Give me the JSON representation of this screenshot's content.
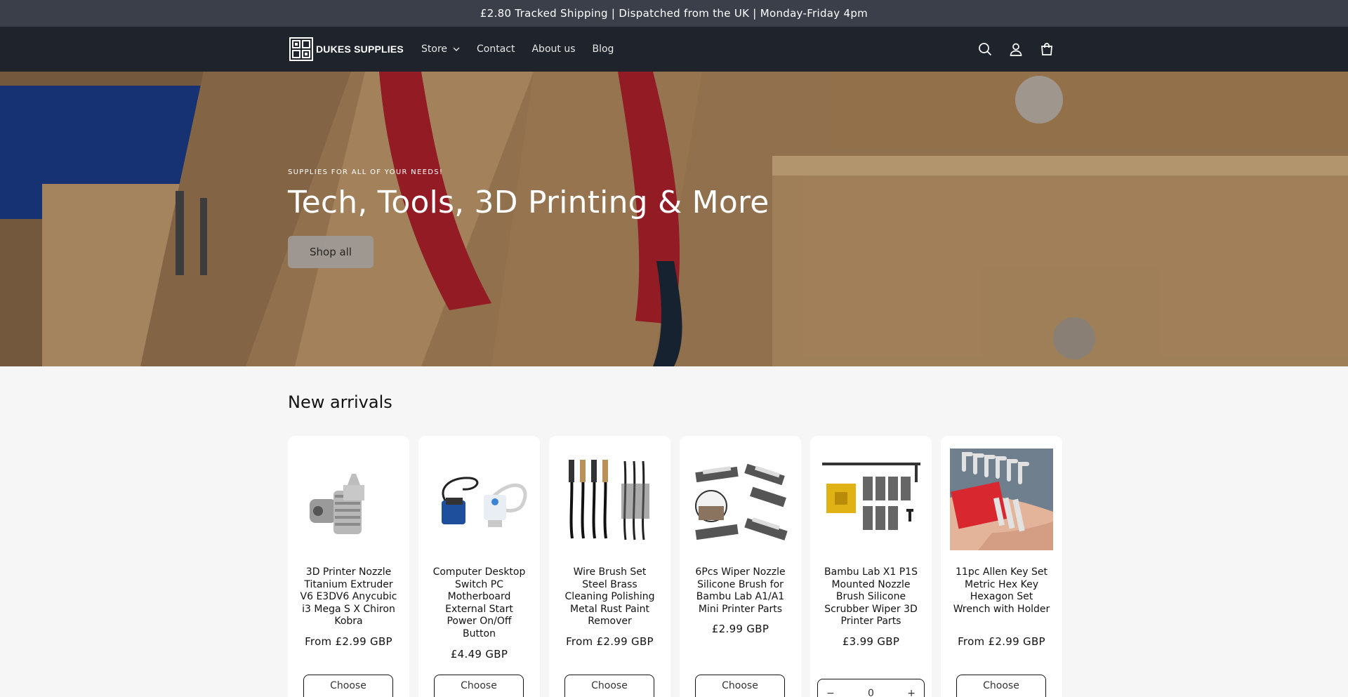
{
  "announcement": "£2.80 Tracked Shipping | Dispatched from the UK | Monday-Friday 4pm",
  "logo_text": "DUKES SUPPLIES",
  "nav": [
    {
      "label": "Store",
      "has_dropdown": true
    },
    {
      "label": "Contact"
    },
    {
      "label": "About us"
    },
    {
      "label": "Blog"
    }
  ],
  "header_icons": [
    "search-icon",
    "account-icon",
    "cart-icon"
  ],
  "hero": {
    "kicker": "SUPPLIES FOR ALL OF YOUR NEEDS!",
    "title": "Tech, Tools, 3D Printing & More",
    "button": "Shop all"
  },
  "section_title": "New arrivals",
  "products": [
    {
      "title": "3D Printer Nozzle Titanium Extruder V6 E3DV6 Anycubic i3 Mega S X Chiron Kobra",
      "price": "From £2.99 GBP",
      "action": "Choose",
      "icon": "nozzle-image"
    },
    {
      "title": "Computer Desktop Switch PC Motherboard External Start Power On/Off Button",
      "price": "£4.49 GBP",
      "action": "Choose",
      "icon": "power-switch-image"
    },
    {
      "title": "Wire Brush Set Steel Brass Cleaning Polishing Metal Rust Paint Remover",
      "price": "From £2.99 GBP",
      "action": "Choose",
      "icon": "wire-brush-image"
    },
    {
      "title": "6Pcs Wiper Nozzle Silicone Brush for Bambu Lab A1/A1 Mini Printer Parts",
      "price": "£2.99 GBP",
      "action": "Choose",
      "icon": "wiper-brush-image"
    },
    {
      "title": "Bambu Lab X1 P1S Mounted Nozzle Brush Silicone Scrubber Wiper 3D Printer Parts",
      "price": "£3.99 GBP",
      "quantity": {
        "minus": "−",
        "value": "0",
        "plus": "+"
      },
      "icon": "scrubber-wiper-image"
    },
    {
      "title": "11pc Allen Key Set Metric Hex Key Hexagon Set Wrench with Holder",
      "price": "From £2.99 GBP",
      "action": "Choose",
      "icon": "allen-key-image"
    }
  ],
  "colors": {
    "announcement_bg": "#3a3f4a",
    "header_bg": "#1f232b",
    "page_bg": "#f6f6f6",
    "hero_button": "#9f9994"
  }
}
